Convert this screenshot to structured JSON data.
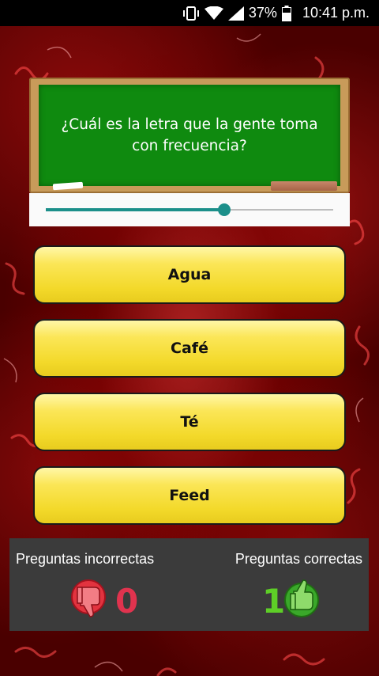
{
  "status_bar": {
    "battery": "37%",
    "time": "10:41 p.m.",
    "icons": [
      "vibrate-icon",
      "wifi-icon",
      "signal-icon",
      "battery-icon"
    ]
  },
  "question": {
    "text": "¿Cuál es la letra que la gente toma con frecuencia?"
  },
  "progress": {
    "value": 0.62,
    "color": "#1c8f8a"
  },
  "answers": [
    {
      "label": "Agua"
    },
    {
      "label": "Café"
    },
    {
      "label": "Té"
    },
    {
      "label": "Feed"
    }
  ],
  "score": {
    "incorrect_label": "Preguntas incorrectas",
    "incorrect_count": "0",
    "incorrect_color": "#e0334e",
    "correct_label": "Preguntas correctas",
    "correct_count": "1",
    "correct_color": "#5ecf27"
  }
}
